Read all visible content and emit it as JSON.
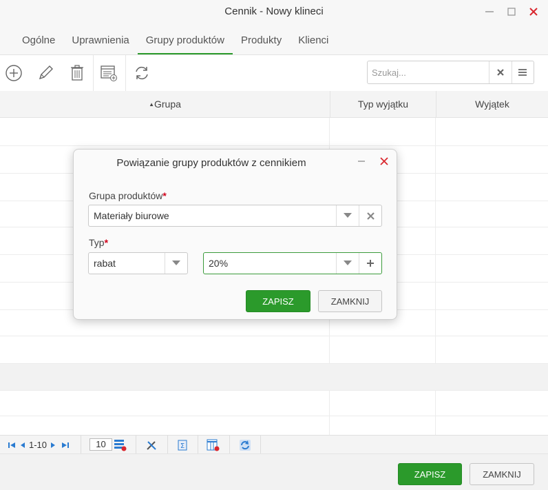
{
  "window": {
    "title": "Cennik - Nowy klineci"
  },
  "tabs": [
    {
      "label": "Ogólne"
    },
    {
      "label": "Uprawnienia"
    },
    {
      "label": "Grupy produktów",
      "active": true
    },
    {
      "label": "Produkty"
    },
    {
      "label": "Klienci"
    }
  ],
  "toolbar": {
    "search_placeholder": "Szukaj...",
    "icons": [
      "add-icon",
      "edit-icon",
      "delete-icon",
      "add-list-icon",
      "refresh-icon"
    ]
  },
  "grid": {
    "columns": [
      {
        "label": "Grupa",
        "sorted": "asc"
      },
      {
        "label": "Typ wyjątku"
      },
      {
        "label": "Wyjątek"
      }
    ],
    "rows": []
  },
  "pager": {
    "range": "1-10",
    "page_size": "10"
  },
  "footer": {
    "save_label": "ZAPISZ",
    "close_label": "ZAMKNIJ"
  },
  "dialog": {
    "title": "Powiązanie grupy produktów z cennikiem",
    "group_label": "Grupa produktów",
    "group_value": "Materiały biurowe",
    "type_label": "Typ",
    "type_value": "rabat",
    "amount_value": "20%",
    "save_label": "ZAPISZ",
    "close_label": "ZAMKNIJ"
  },
  "colors": {
    "accent": "#2b9a2b",
    "required": "#d0021b",
    "close_red": "#d9272e"
  }
}
